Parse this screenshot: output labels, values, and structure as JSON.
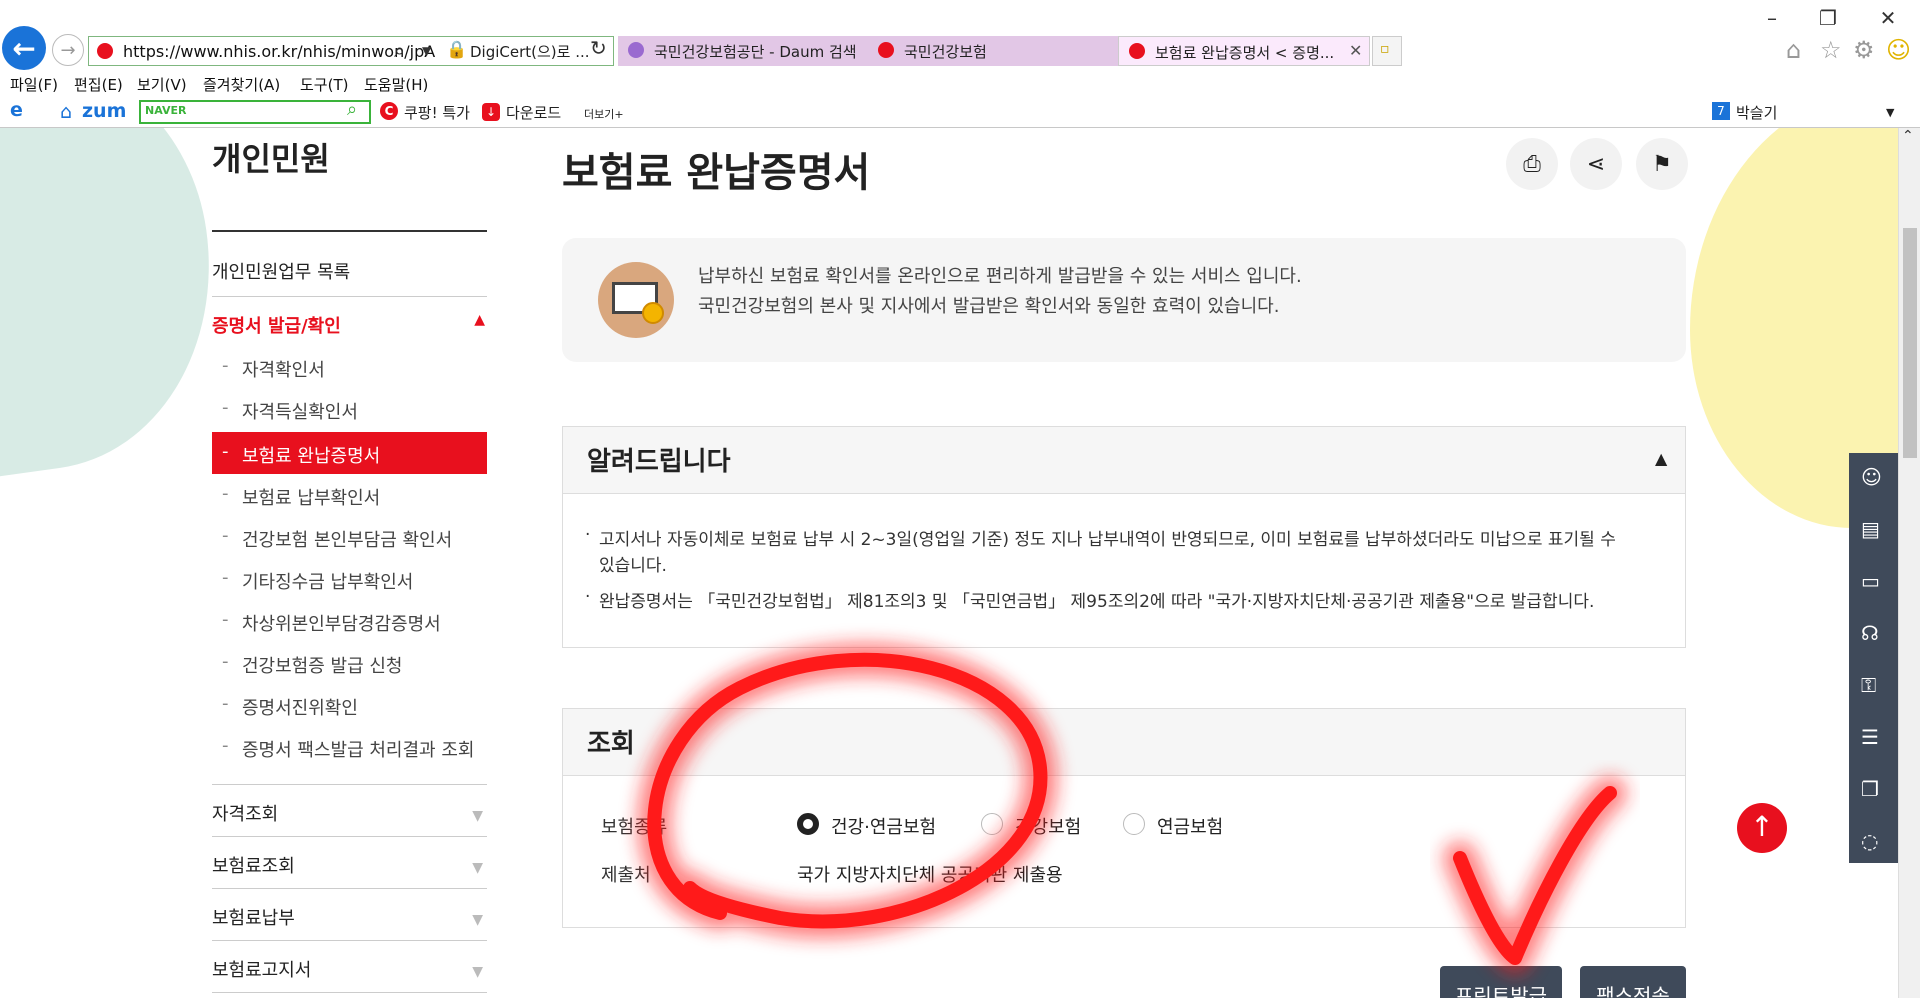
{
  "browser": {
    "url": "https://www.nhis.or.kr/nhis/minwon/jpA",
    "cert": "DigiCert(으)로 ...",
    "tabs": [
      {
        "label": "국민건강보험공단 - Daum 검색"
      },
      {
        "label": "국민건강보험"
      },
      {
        "label": "보험료 완납증명서 < 증명..."
      }
    ],
    "menu": [
      "파일(F)",
      "편집(E)",
      "보기(V)",
      "즐겨찾기(A)",
      "도구(T)",
      "도움말(H)"
    ],
    "favorites": {
      "zum": "zum",
      "naver": "NAVER",
      "coupang": "쿠팡! 특가",
      "download": "다운로드",
      "more": "더보기+",
      "weather": "박슬기",
      "weather_num": "7"
    }
  },
  "sidebar": {
    "title": "개인민원",
    "list_link": "개인민원업무 목록",
    "section": "증명서 발급/확인",
    "sub_items": [
      "자격확인서",
      "자격득실확인서",
      "보험료 완납증명서",
      "보험료 납부확인서",
      "건강보험 본인부담금 확인서",
      "기타징수금 납부확인서",
      "차상위본인부담경감증명서",
      "건강보험증 발급 신청",
      "증명서진위확인",
      "증명서 팩스발급 처리결과 조회"
    ],
    "collapsed": [
      "자격조회",
      "보험료조회",
      "보험료납부",
      "보험료고지서"
    ]
  },
  "main": {
    "title": "보험료 완납증명서",
    "info_lines": [
      "납부하신 보험료 확인서를 온라인으로 편리하게 발급받을 수 있는 서비스 입니다.",
      "국민건강보험의 본사 및 지사에서 발급받은 확인서와 동일한 효력이 있습니다."
    ],
    "notice_title": "알려드립니다",
    "notices": [
      "고지서나 자동이체로 보험료 납부 시 2~3일(영업일 기준) 정도 지나 납부내역이 반영되므로, 이미 보험료를 납부하셨더라도 미납으로 표기될 수",
      "있습니다.",
      "완납증명서는 「국민건강보험법」 제81조의3 및 「국민연금법」 제95조의2에 따라 \"국가·지방자치단체·공공기관 제출용\"으로 발급합니다."
    ],
    "query_title": "조회",
    "row1_label": "보험종류",
    "radios": [
      "건강·연금보험",
      "건강보험",
      "연금보험"
    ],
    "row2_label": "제출처",
    "row2_value": "국가 지방자치단체 공공기관 제출용",
    "print_button": "프린트발급",
    "fax_button": "팩스전송"
  },
  "colors": {
    "accent_red": "#e8101e",
    "dark_panel": "#3f4a5a"
  }
}
